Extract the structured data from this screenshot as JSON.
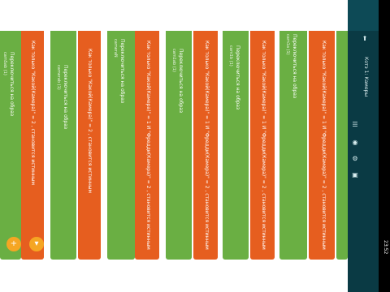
{
  "app": {
    "title": "Котэ 1: Камеры",
    "time": "23:52"
  },
  "icons": {
    "back": "back-arrow-icon",
    "menu": "menu-icon",
    "pin": "pin-icon",
    "settings": "settings-icon",
    "camera": "camera-icon",
    "add": "add-icon",
    "fab1": "plus-icon",
    "fab2": "chevron-icon"
  },
  "strips": [
    {
      "kind": "green",
      "text": "Переключиться на образ",
      "sub": "camSab (1)"
    },
    {
      "kind": "orange",
      "text": "Как только \"Какой(Камера)\" = 2 , становится истинным"
    },
    {
      "kind": "green",
      "text": "Переключиться на образ",
      "sub": "camerab (1)"
    },
    {
      "kind": "orange",
      "text": "Как только \"Какой(Камера)\" = 2 , становится истинным"
    },
    {
      "kind": "green",
      "text": "Переключиться на образ",
      "sub": "cameraN"
    },
    {
      "kind": "orange",
      "text": "Как только \"Какой(Камера)\" = 1 И \"Фредди(Камера)\" = 2 , становится истинным"
    },
    {
      "kind": "green",
      "text": "Переключиться на образ",
      "sub": "cam1ab (1)"
    },
    {
      "kind": "orange",
      "text": "Как только \"Какой(Камера)\" = 1 И \"Фредди(Камера)\" = 2 , становится истинным"
    },
    {
      "kind": "green",
      "text": "Переключиться на образ",
      "sub": "cam1b (1)"
    },
    {
      "kind": "orange",
      "text": "Как только \"Какой(Камера)\" = 1 И \"Фредди(Камера)\" = 2 , становится истинным"
    },
    {
      "kind": "green",
      "text": "Переключиться на образ",
      "sub": "cam1a (1)"
    },
    {
      "kind": "orange",
      "text": "Как только \"Какой(Камера)\" = 1 И \"Фредди(Камера)\" = 2 , становится истинным"
    },
    {
      "kind": "green",
      "text": "",
      "sub": ""
    }
  ],
  "colors": {
    "green": "#6aaf43",
    "orange": "#e65e1f",
    "sidebar": "#0a3a44",
    "fab": "#f5a623"
  }
}
